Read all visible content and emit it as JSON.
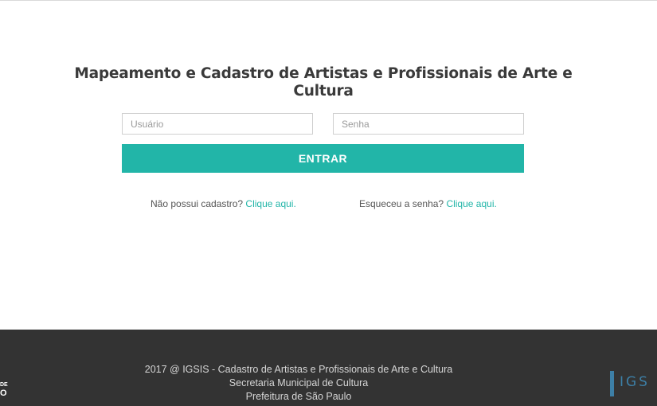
{
  "page": {
    "title": "Mapeamento e Cadastro de Artistas e Profissionais de Arte e Cultura"
  },
  "login": {
    "username_placeholder": "Usuário",
    "password_placeholder": "Senha",
    "submit_label": "ENTRAR"
  },
  "help": {
    "register_text": "Não possui cadastro?",
    "register_link": "Clique aqui.",
    "forgot_text": "Esqueceu a senha?",
    "forgot_link": "Clique aqui."
  },
  "footer": {
    "line1": "2017 @ IGSIS - Cadastro de Artistas e Profissionais de Arte e Cultura",
    "line2": "Secretaria Municipal de Cultura",
    "line3": "Prefeitura de São Paulo",
    "sp_logo_small": "DE",
    "sp_logo_big": "O",
    "igsis_logo": "IGS"
  },
  "colors": {
    "accent": "#22b5a8",
    "footer_bg": "#333333",
    "igsis_blue": "#3d7fa6"
  }
}
